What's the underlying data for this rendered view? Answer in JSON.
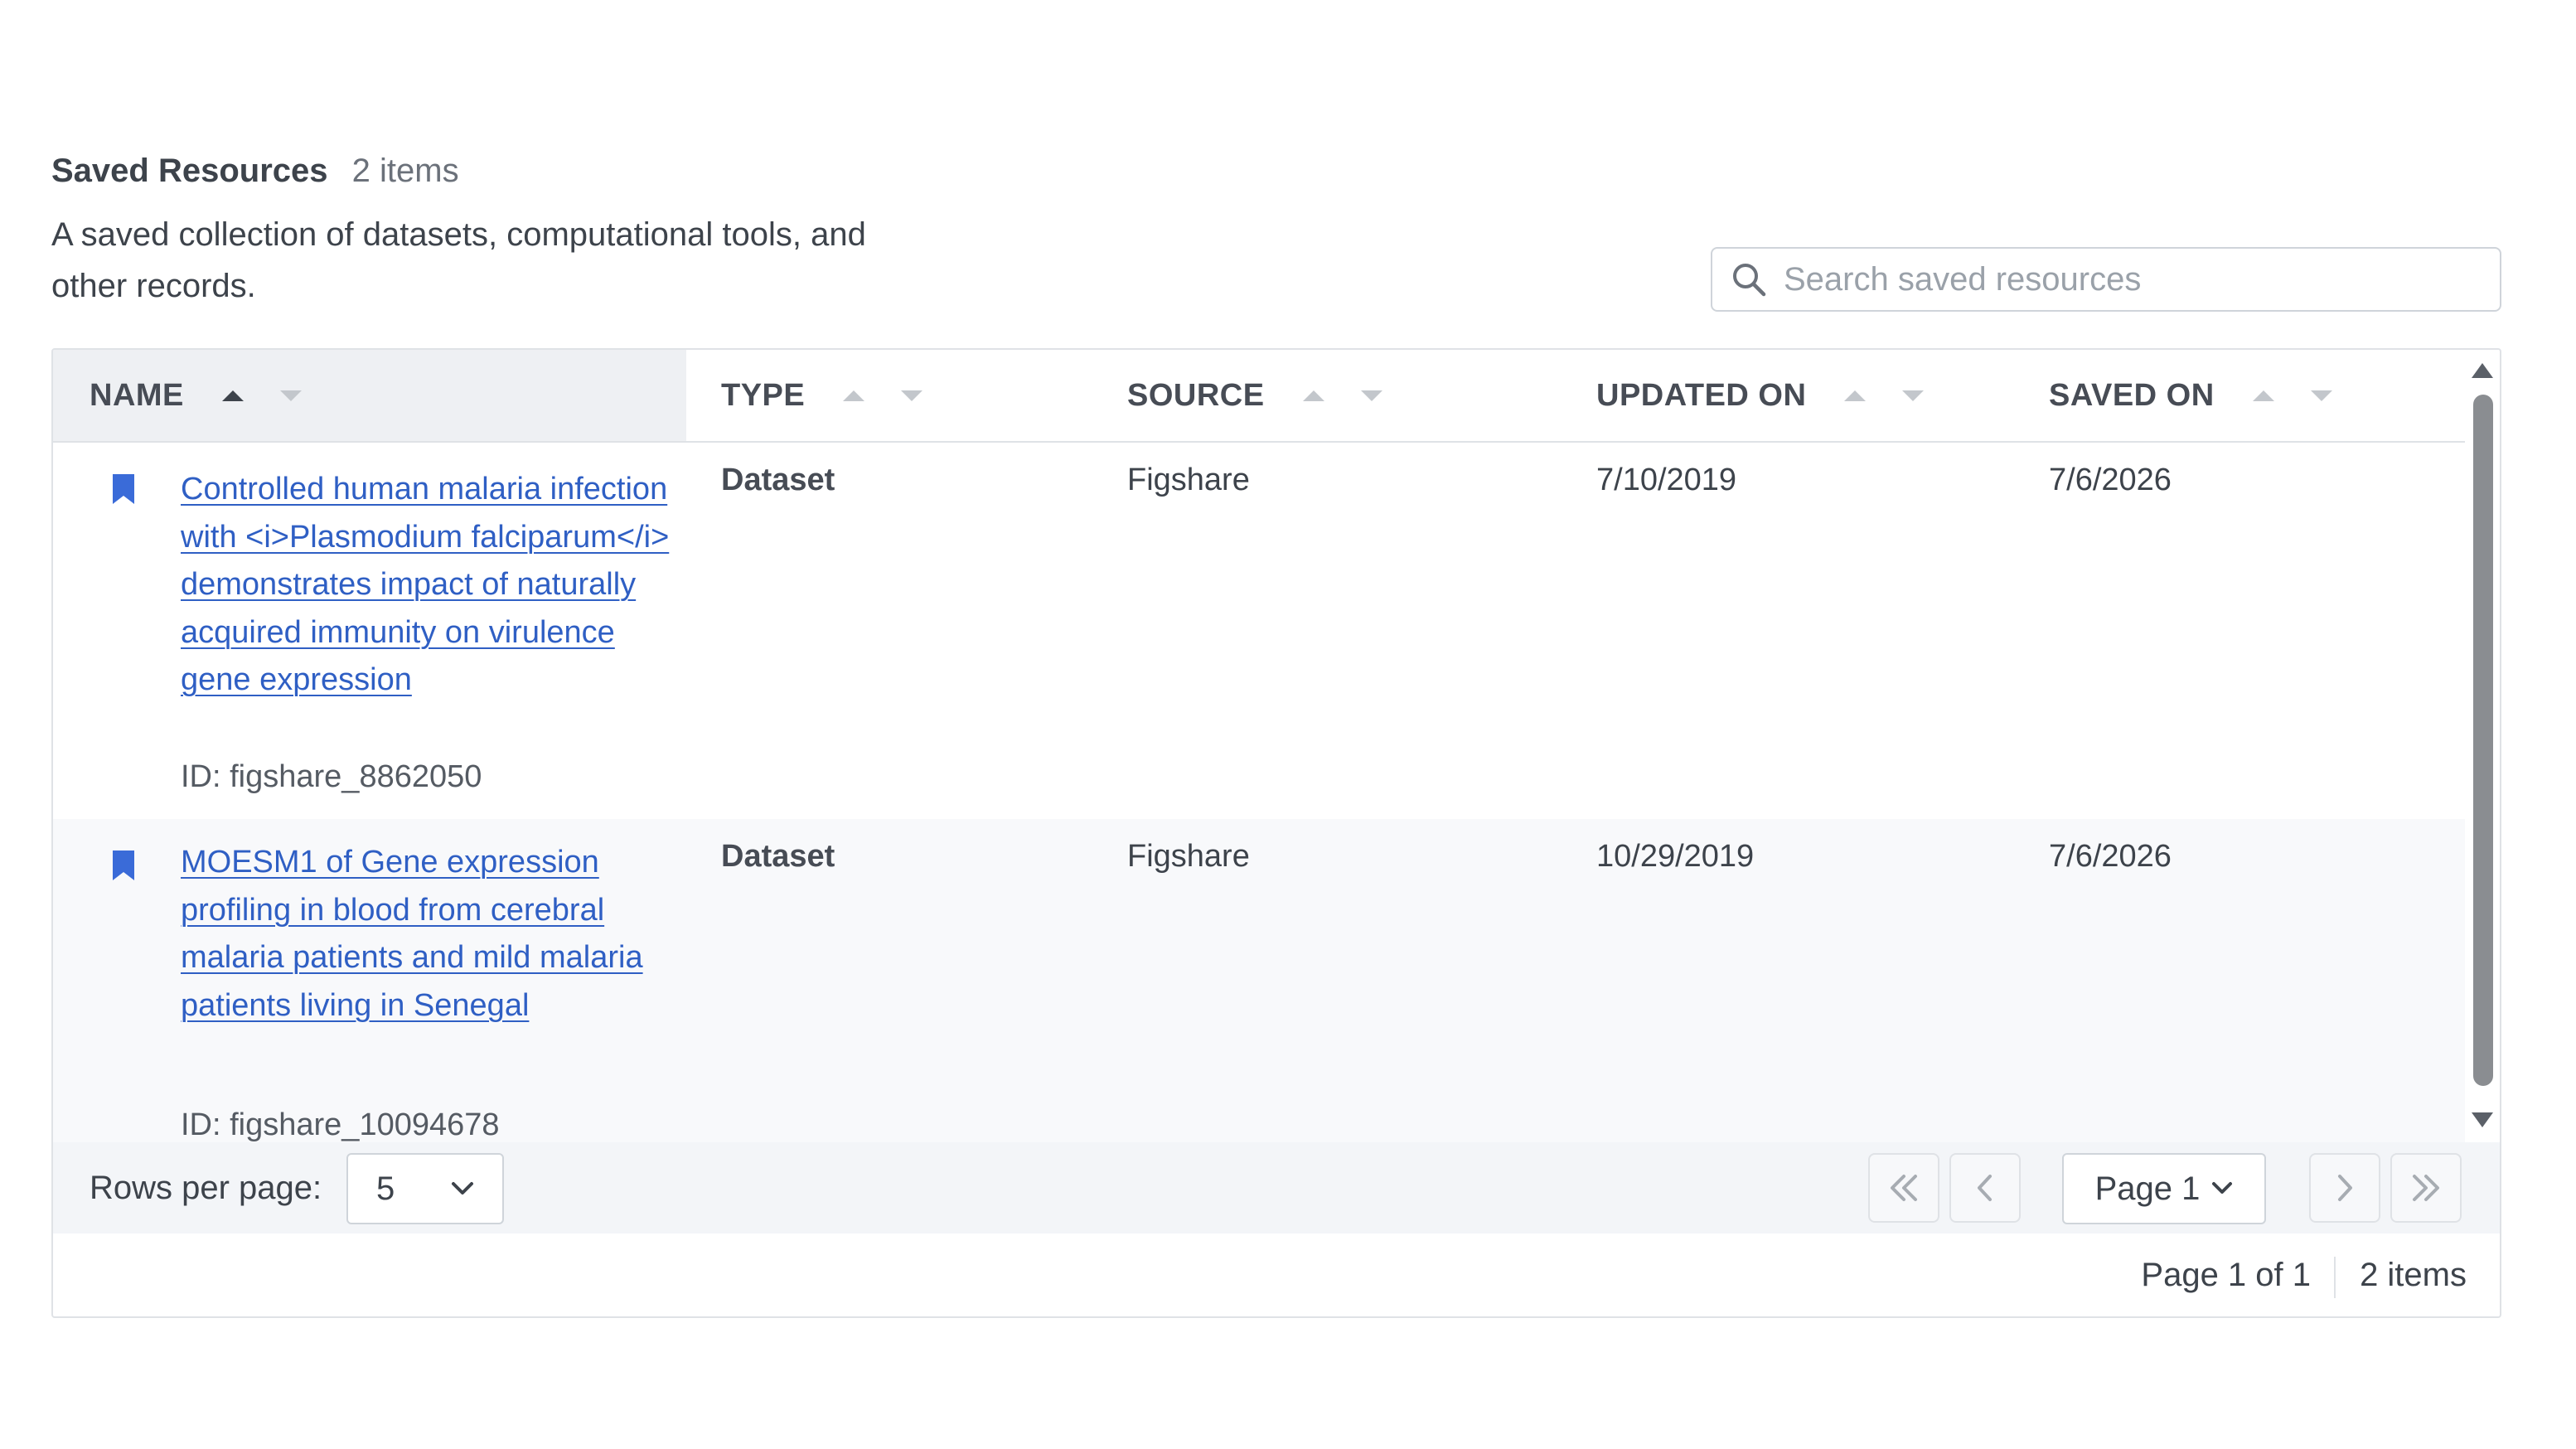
{
  "header": {
    "title": "Saved Resources",
    "count": "2 items",
    "description": "A saved collection of datasets, computational tools, and other records."
  },
  "search": {
    "placeholder": "Search saved resources",
    "value": ""
  },
  "table": {
    "columns": [
      "NAME",
      "TYPE",
      "SOURCE",
      "UPDATED ON",
      "SAVED ON"
    ],
    "sorted_column": "NAME",
    "sort_direction": "ascending",
    "rows": [
      {
        "title": "Controlled human malaria infection with <i>Plasmodium falciparum</i> demonstrates impact of naturally acquired immunity on virulence gene expression",
        "id": "ID: figshare_8862050",
        "type": "Dataset",
        "source": "Figshare",
        "updated_on": "7/10/2019",
        "saved_on": "7/6/2026"
      },
      {
        "title": "MOESM1 of Gene expression profiling in blood from cerebral malaria patients and mild malaria patients living in Senegal",
        "id": "ID: figshare_10094678",
        "type": "Dataset",
        "source": "Figshare",
        "updated_on": "10/29/2019",
        "saved_on": "7/6/2026"
      }
    ]
  },
  "pagination": {
    "rows_per_page_label": "Rows per page:",
    "rows_per_page": "5",
    "page_select": "Page 1",
    "page_of": "Page 1 of 1",
    "total_items": "2 items"
  },
  "colors": {
    "link": "#2f5fc4",
    "bookmark": "#3a6bd8",
    "header_bg": "#eef0f3",
    "footer_bg": "#f3f5f8"
  }
}
